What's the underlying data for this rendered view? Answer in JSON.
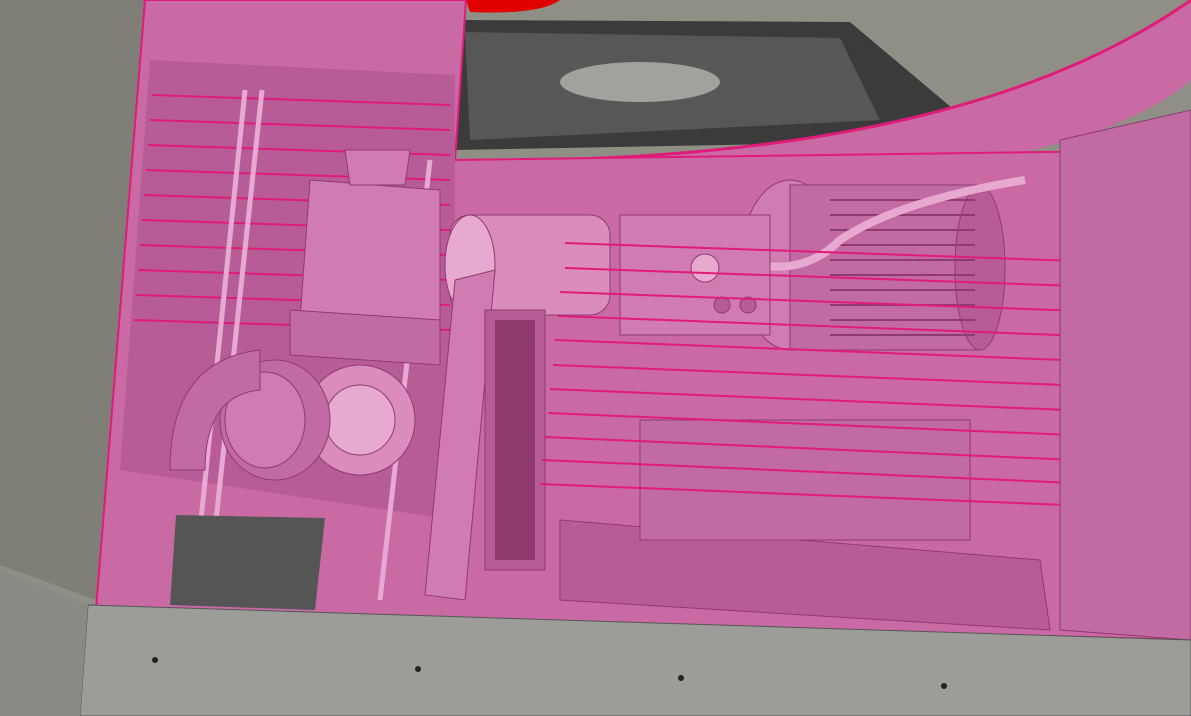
{
  "app": {
    "view_type": "3d-cad-viewport",
    "mode": "section-view",
    "notes": ""
  },
  "colors": {
    "background_grey": "#8f8f86",
    "floor_grey": "#9c9c98",
    "highlight_pink": "#c96aa5",
    "highlight_pink_light": "#e7a9cf",
    "highlight_pink_dark": "#8f3b6f",
    "edge_magenta": "#e01b7a",
    "red_part": "#e10000",
    "dark_grating": "#3b3b3b",
    "panel_grey": "#a2a29c"
  },
  "scene": {
    "objects": [
      {
        "name": "enclosure-panel",
        "icon": "box-icon"
      },
      {
        "name": "motor",
        "icon": "motor-icon"
      },
      {
        "name": "coupling-housing",
        "icon": "gear-icon"
      },
      {
        "name": "pipe-elbow",
        "icon": "pipe-icon"
      },
      {
        "name": "control-panel",
        "icon": "panel-icon"
      },
      {
        "name": "floor-plate",
        "icon": "plate-icon"
      }
    ]
  }
}
